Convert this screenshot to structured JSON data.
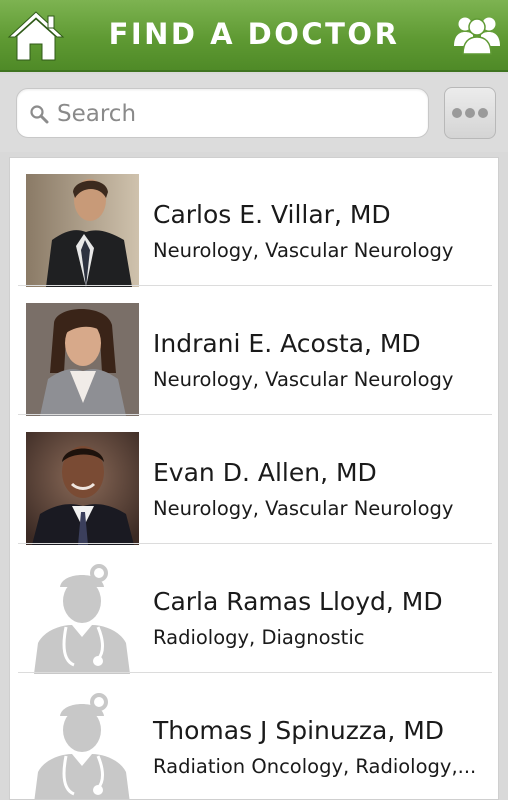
{
  "header": {
    "title": "FIND A DOCTOR",
    "home_icon": "home-icon",
    "group_icon": "people-group-icon",
    "bg_color": "#5f9a33"
  },
  "search": {
    "placeholder": "Search",
    "value": "",
    "more_icon": "more-dots-icon"
  },
  "doctors": [
    {
      "name": "Carlos E. Villar, MD",
      "specialty": "Neurology, Vascular Neurology",
      "photo": "photo-man-suit-striped-tie"
    },
    {
      "name": "Indrani E. Acosta, MD",
      "specialty": "Neurology, Vascular Neurology",
      "photo": "photo-woman-gray-blazer"
    },
    {
      "name": "Evan D. Allen, MD",
      "specialty": "Neurology, Vascular Neurology",
      "photo": "photo-man-dark-suit"
    },
    {
      "name": "Carla Ramas Lloyd, MD",
      "specialty": "Radiology, Diagnostic",
      "photo": "placeholder-doctor-silhouette"
    },
    {
      "name": "Thomas J Spinuzza, MD",
      "specialty": "Radiation Oncology, Radiology,...",
      "photo": "placeholder-doctor-silhouette"
    }
  ]
}
